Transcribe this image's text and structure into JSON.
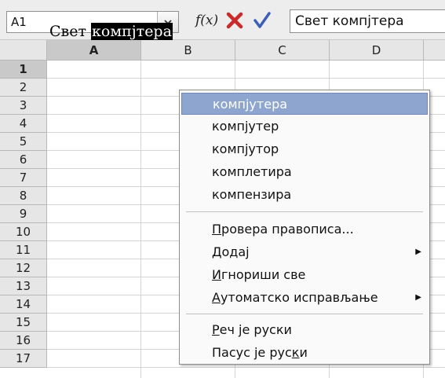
{
  "formula_bar": {
    "name_box_value": "A1",
    "function_label": "f(x)",
    "formula_value": "Свет компјтера"
  },
  "columns": [
    "A",
    "B",
    "C",
    "D"
  ],
  "rows": [
    "1",
    "2",
    "3",
    "4",
    "5",
    "6",
    "7",
    "8",
    "9",
    "10",
    "11",
    "12",
    "13",
    "14",
    "15",
    "16",
    "17"
  ],
  "cell_a1": {
    "plain": "Свет ",
    "misspelled": "компјтера"
  },
  "context_menu": {
    "suggestions": [
      "компјутера",
      "компјутер",
      "компјутор",
      "комплетира",
      "компензира"
    ],
    "actions": {
      "spellcheck": {
        "pre": "",
        "ul": "П",
        "post": "ровера правописа..."
      },
      "add": {
        "pre": "",
        "ul": "Д",
        "post": "одај"
      },
      "ignore_all": {
        "pre": "",
        "ul": "И",
        "post": "гнориши све"
      },
      "autocorrect": {
        "pre": "",
        "ul": "А",
        "post": "утоматско исправљање"
      },
      "word_is_russian": {
        "pre": "",
        "ul": "Р",
        "post": "еч је руски"
      },
      "paragraph_is_russian": {
        "pre": "Пасус је рус",
        "ul": "к",
        "post": "и"
      }
    }
  },
  "colors": {
    "menu_highlight": "#8ea6cf",
    "cancel_icon": "#cc2a2a",
    "accept_icon": "#3b5fb8"
  }
}
